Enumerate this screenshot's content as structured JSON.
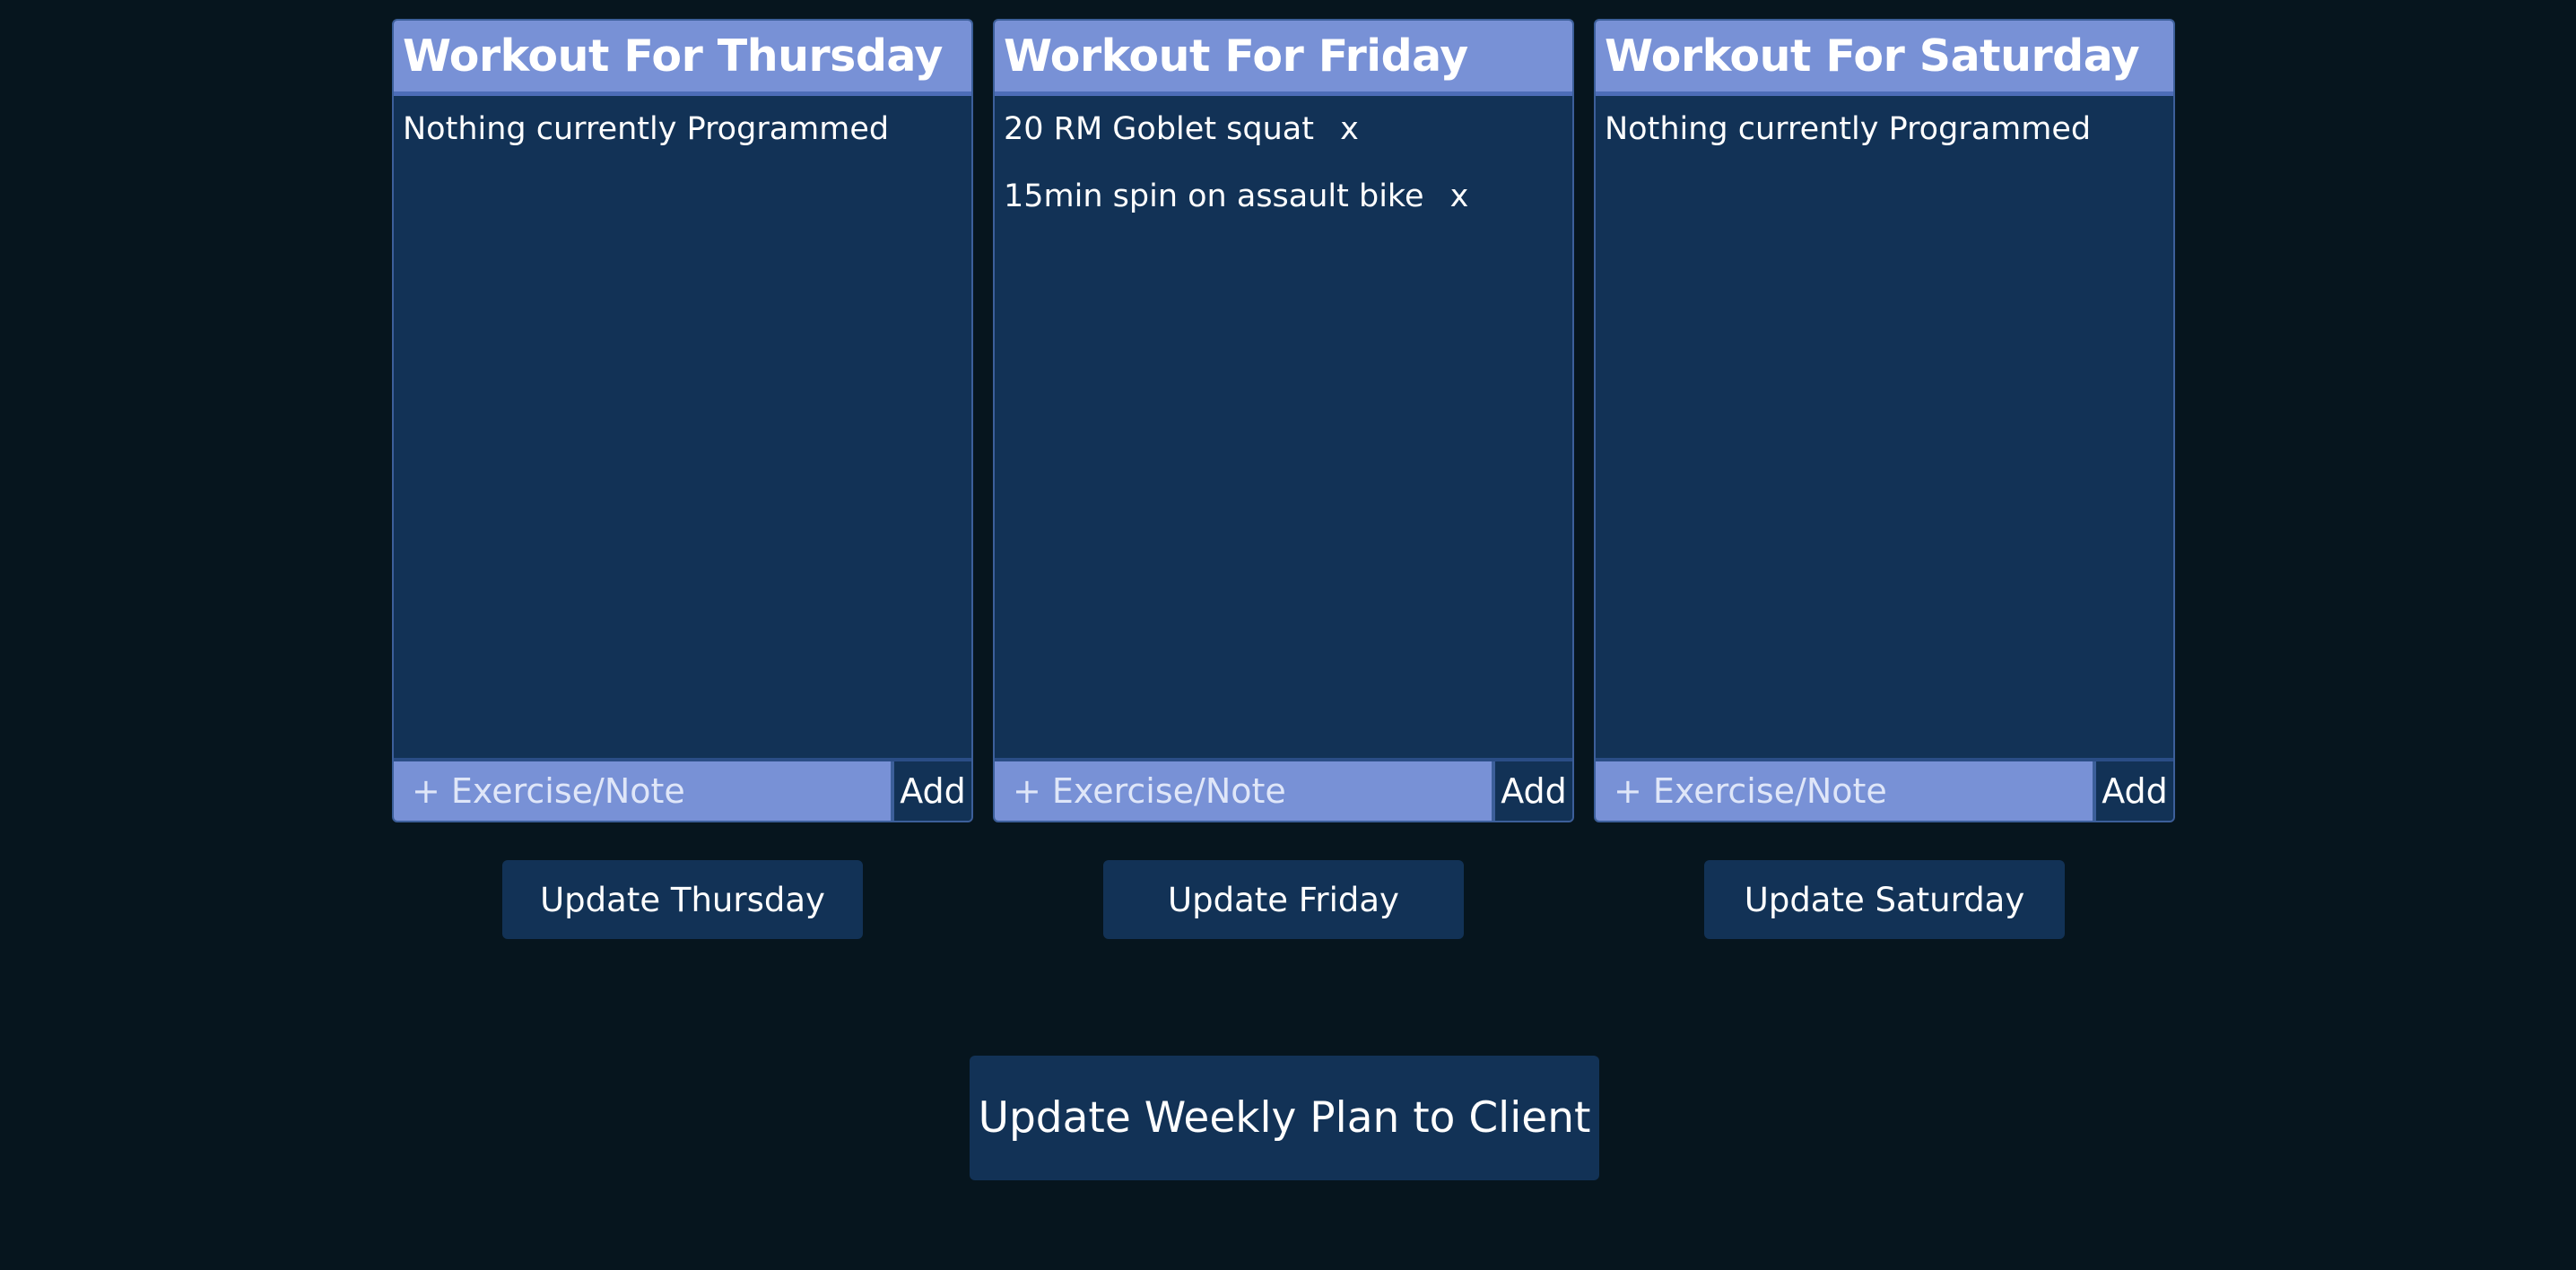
{
  "days": [
    {
      "title": "Workout For Thursday",
      "empty_text": "Nothing currently Programmed",
      "exercises": [],
      "input_placeholder": "+ Exercise/Note",
      "add_label": "Add",
      "update_label": "Update Thursday"
    },
    {
      "title": "Workout For Friday",
      "empty_text": "",
      "exercises": [
        {
          "text": "20 RM Goblet squat",
          "remove": "x"
        },
        {
          "text": "15min spin on assault bike",
          "remove": "x"
        }
      ],
      "input_placeholder": "+ Exercise/Note",
      "add_label": "Add",
      "update_label": "Update Friday"
    },
    {
      "title": "Workout For Saturday",
      "empty_text": "Nothing currently Programmed",
      "exercises": [],
      "input_placeholder": "+ Exercise/Note",
      "add_label": "Add",
      "update_label": "Update Saturday"
    }
  ],
  "weekly_update_label": "Update Weekly Plan to Client",
  "colors": {
    "background": "#06151e",
    "card": "#123256",
    "header": "#7891d6",
    "accent_border": "#3c5f9a"
  }
}
